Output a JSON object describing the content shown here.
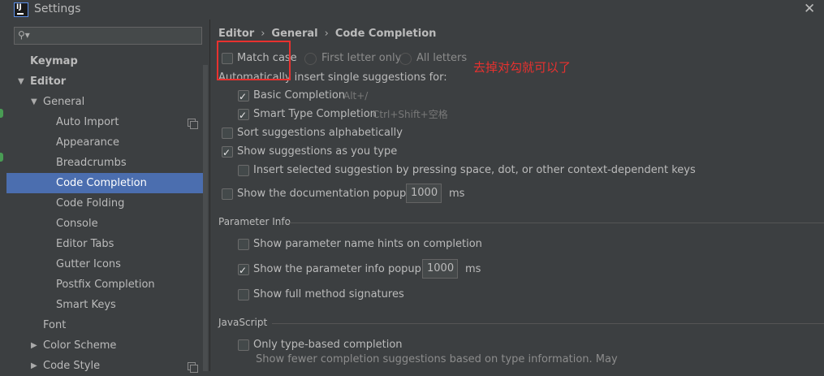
{
  "window": {
    "title": "Settings",
    "app_icon_text": "IJ"
  },
  "search": {
    "placeholder": ""
  },
  "sidebar": {
    "items": [
      {
        "label": "Keymap"
      },
      {
        "label": "Editor"
      },
      {
        "label": "General"
      },
      {
        "label": "Auto Import"
      },
      {
        "label": "Appearance"
      },
      {
        "label": "Breadcrumbs"
      },
      {
        "label": "Code Completion"
      },
      {
        "label": "Code Folding"
      },
      {
        "label": "Console"
      },
      {
        "label": "Editor Tabs"
      },
      {
        "label": "Gutter Icons"
      },
      {
        "label": "Postfix Completion"
      },
      {
        "label": "Smart Keys"
      },
      {
        "label": "Font"
      },
      {
        "label": "Color Scheme"
      },
      {
        "label": "Code Style"
      }
    ]
  },
  "breadcrumb": {
    "part1": "Editor",
    "part2": "General",
    "part3": "Code Completion"
  },
  "options": {
    "match_case": "Match case",
    "first_letter_only": "First letter only",
    "all_letters": "All letters",
    "auto_insert_label": "Automatically insert single suggestions for:",
    "basic_completion": "Basic Completion",
    "basic_shortcut": "Alt+/",
    "smart_type_completion": "Smart Type Completion",
    "smart_shortcut": "Ctrl+Shift+空格",
    "sort_alpha": "Sort suggestions alphabetically",
    "show_as_you_type": "Show suggestions as you type",
    "insert_selected": "Insert selected suggestion by pressing space, dot, or other context-dependent keys",
    "show_doc_popup": "Show the documentation popup in",
    "doc_popup_ms": "1000",
    "ms1": "ms"
  },
  "parameter_info": {
    "title": "Parameter Info",
    "show_name_hints": "Show parameter name hints on completion",
    "show_info_popup": "Show the parameter info popup in",
    "info_popup_ms": "1000",
    "ms2": "ms",
    "show_full_signatures": "Show full method signatures"
  },
  "javascript": {
    "title": "JavaScript",
    "only_type_based": "Only type-based completion",
    "description": "Show fewer completion suggestions based on type information. May"
  },
  "annotation": {
    "text": "去掉对勾就可以了"
  },
  "colors": {
    "selection": "#4b6eaf",
    "annotation_red": "#e8312f",
    "background": "#3c3f41"
  }
}
